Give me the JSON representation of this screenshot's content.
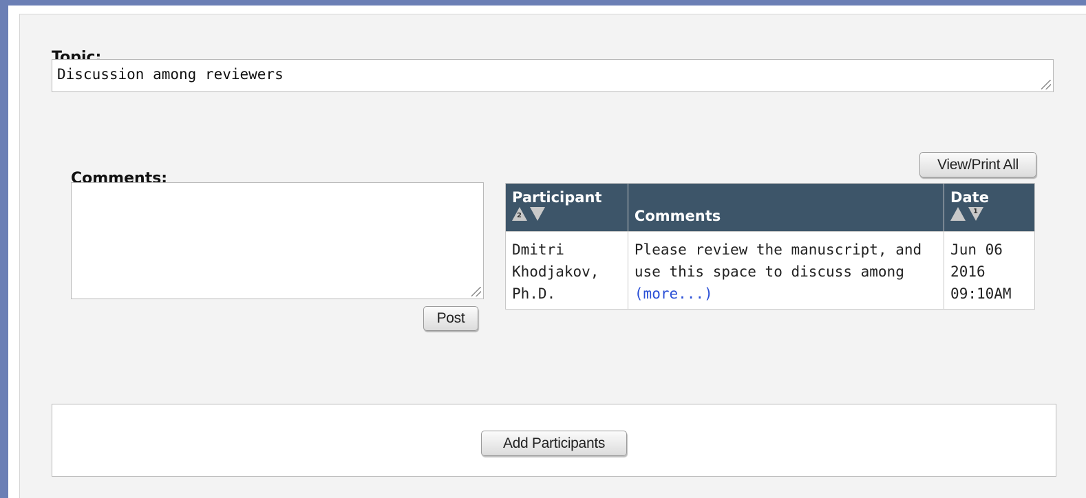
{
  "topic": {
    "label": "Topic:",
    "value": "Discussion among reviewers"
  },
  "comments": {
    "label": "Comments:",
    "value": "",
    "post_label": "Post"
  },
  "view_print_label": "View/Print All",
  "table": {
    "headers": {
      "participant": "Participant",
      "comments": "Comments",
      "date": "Date"
    },
    "sort": {
      "participant_rank": "2",
      "date_rank": "1"
    },
    "rows": [
      {
        "participant": "Dmitri Khodjakov, Ph.D.",
        "comment": "Please review the manuscript, and use this space to discuss among",
        "more_link": "(more...)",
        "date": "Jun 06 2016 09:10AM"
      }
    ]
  },
  "add_participants_label": "Add Participants",
  "colors": {
    "frame": "#6b7fb5",
    "table_header": "#3d5569",
    "link": "#2a4fd6"
  }
}
